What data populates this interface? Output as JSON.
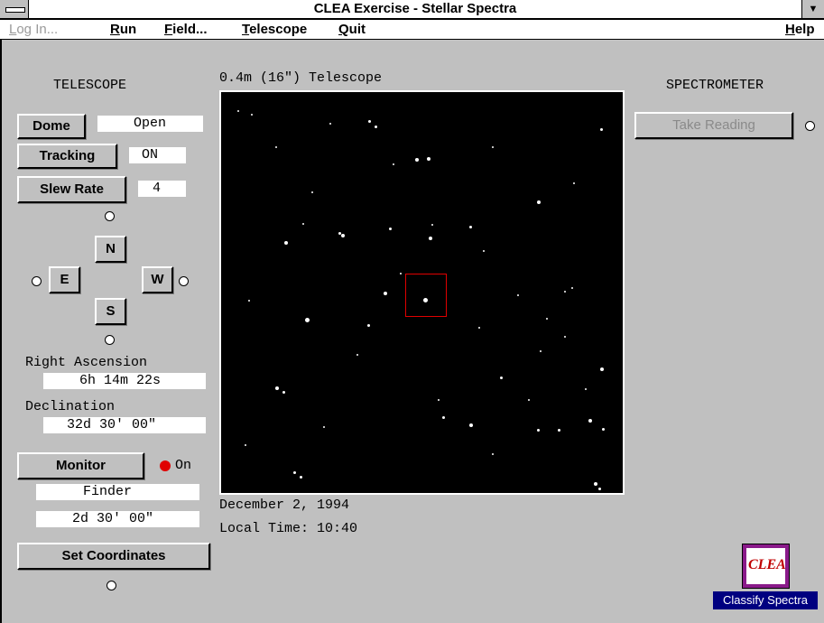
{
  "window": {
    "title": "CLEA Exercise - Stellar Spectra",
    "dropdown_glyph": "▼"
  },
  "menu": {
    "login": {
      "prefix": "L",
      "rest": "og In..."
    },
    "run": {
      "prefix": "R",
      "rest": "un"
    },
    "field": {
      "prefix": "F",
      "rest": "ield..."
    },
    "telescope": {
      "prefix": "T",
      "rest": "elescope"
    },
    "quit": {
      "prefix": "Q",
      "rest": "uit"
    },
    "help": {
      "prefix": "H",
      "rest": "elp"
    }
  },
  "telescope": {
    "heading": "TELESCOPE",
    "dome": {
      "label": "Dome",
      "value": "Open"
    },
    "tracking": {
      "label": "Tracking",
      "value": "ON"
    },
    "slew_rate": {
      "label": "Slew Rate",
      "value": "4"
    },
    "direction_buttons": {
      "north": "N",
      "south": "S",
      "east": "E",
      "west": "W"
    },
    "ra_label": "Right Ascension",
    "ra_value": "6h 14m 22s",
    "dec_label": "Declination",
    "dec_value": "32d 30' 00\"",
    "monitor": {
      "label": "Monitor",
      "status": "On",
      "mode": "Finder",
      "field_size": "2d 30' 00\""
    },
    "set_coordinates": "Set Coordinates"
  },
  "view": {
    "title": "0.4m (16\") Telescope",
    "date": "December 2, 1994",
    "local_time": "Local Time: 10:40"
  },
  "spectrometer": {
    "heading": "SPECTROMETER",
    "take_reading": "Take Reading"
  },
  "logo": {
    "text": "CLEA",
    "caption": "Classify Spectra"
  },
  "colors": {
    "status_red": "#e00000",
    "reticle": "#e00000",
    "logo_bg": "#8a1a8a",
    "caption_bg": "#000080"
  }
}
